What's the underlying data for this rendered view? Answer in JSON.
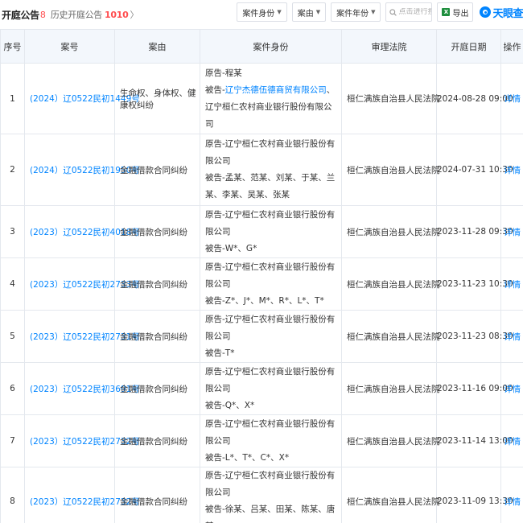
{
  "header": {
    "title": "开庭公告",
    "count": "8",
    "history_label": "历史开庭公告",
    "history_count": "1010",
    "history_chevron": "〉",
    "filters": [
      {
        "label": "案件身份"
      },
      {
        "label": "案由"
      },
      {
        "label": "案件年份"
      }
    ],
    "search_placeholder": "点击进行搜索",
    "export_label": "导出",
    "logo_text": "天眼查"
  },
  "table": {
    "columns": [
      "序号",
      "案号",
      "案由",
      "案件身份",
      "审理法院",
      "开庭日期",
      "操作"
    ],
    "rows": [
      {
        "index": "1",
        "case_no": "(2024）辽0522民初1449号",
        "cause": "生命权、身体权、健康权纠纷",
        "plaintiff": "原告-程某",
        "defendant_prefix": "被告-",
        "defendant_link": "辽宁杰德伍德商贸有限公司",
        "defendant_rest": "、辽宁桓仁农村商业银行股份有限公司",
        "court": "桓仁满族自治县人民法院",
        "date": "2024-08-28 09:00",
        "op": "详情"
      },
      {
        "index": "2",
        "case_no": "(2024）辽0522民初1950号",
        "cause": "金融借款合同纠纷",
        "plaintiff": "原告-辽宁桓仁农村商业银行股份有限公司",
        "defendant_prefix": "被告-",
        "defendant_link": "",
        "defendant_rest": "孟某、范某、刘某、于某、兰某、李某、吴某、张某",
        "court": "桓仁满族自治县人民法院",
        "date": "2024-07-31 10:30",
        "op": "详情"
      },
      {
        "index": "3",
        "case_no": "(2023）辽0522民初4018号",
        "cause": "金融借款合同纠纷",
        "plaintiff": "原告-辽宁桓仁农村商业银行股份有限公司",
        "defendant_prefix": "被告-",
        "defendant_link": "",
        "defendant_rest": "W*、G*",
        "court": "桓仁满族自治县人民法院",
        "date": "2023-11-28 09:30",
        "op": "详情"
      },
      {
        "index": "4",
        "case_no": "(2023）辽0522民初2733号",
        "cause": "金融借款合同纠纷",
        "plaintiff": "原告-辽宁桓仁农村商业银行股份有限公司",
        "defendant_prefix": "被告-",
        "defendant_link": "",
        "defendant_rest": "Z*、J*、M*、R*、L*、T*",
        "court": "桓仁满族自治县人民法院",
        "date": "2023-11-23 10:30",
        "op": "详情"
      },
      {
        "index": "5",
        "case_no": "(2023）辽0522民初2731号",
        "cause": "金融借款合同纠纷",
        "plaintiff": "原告-辽宁桓仁农村商业银行股份有限公司",
        "defendant_prefix": "被告-",
        "defendant_link": "",
        "defendant_rest": "T*",
        "court": "桓仁满族自治县人民法院",
        "date": "2023-11-23 08:30",
        "op": "详情"
      },
      {
        "index": "6",
        "case_no": "(2023）辽0522民初3691号",
        "cause": "金融借款合同纠纷",
        "plaintiff": "原告-辽宁桓仁农村商业银行股份有限公司",
        "defendant_prefix": "被告-",
        "defendant_link": "",
        "defendant_rest": "Q*、X*",
        "court": "桓仁满族自治县人民法院",
        "date": "2023-11-16 09:00",
        "op": "详情"
      },
      {
        "index": "7",
        "case_no": "(2023）辽0522民初2732号",
        "cause": "金融借款合同纠纷",
        "plaintiff": "原告-辽宁桓仁农村商业银行股份有限公司",
        "defendant_prefix": "被告-",
        "defendant_link": "",
        "defendant_rest": "L*、T*、C*、X*",
        "court": "桓仁满族自治县人民法院",
        "date": "2023-11-14 13:00",
        "op": "详情"
      },
      {
        "index": "8",
        "case_no": "(2023）辽0522民初2732号",
        "cause": "金融借款合同纠纷",
        "plaintiff": "原告-辽宁桓仁农村商业银行股份有限公司",
        "defendant_prefix": "被告-",
        "defendant_link": "",
        "defendant_rest": "徐某、吕某、田某、陈某、唐某",
        "court": "桓仁满族自治县人民法院",
        "date": "2023-11-09 13:30",
        "op": "详情"
      }
    ]
  },
  "colors": {
    "accent": "#0084ff",
    "count_red": "#ff4d4f",
    "header_bg": "#f3f7fc",
    "border": "#e4e8ee"
  }
}
